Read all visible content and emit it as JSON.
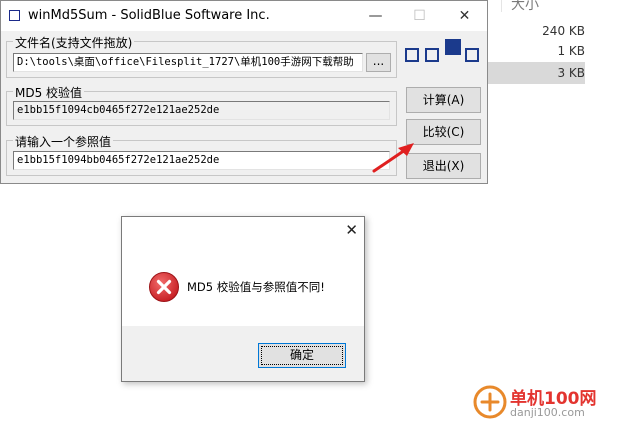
{
  "explorer": {
    "header": "大小",
    "sizes": [
      "240 KB",
      "1 KB",
      "3 KB"
    ]
  },
  "window": {
    "title": "winMd5Sum - SolidBlue Software Inc.",
    "controls": {
      "minimize": "—",
      "maximize": "☐",
      "close": "✕"
    },
    "file_group": {
      "legend": "文件名(支持文件拖放)",
      "path": "D:\\tools\\桌面\\office\\Filesplit_1727\\单机100手游网下载帮助",
      "browse": "..."
    },
    "md5_group": {
      "legend": "MD5 校验值",
      "value": "e1bb15f1094cb0465f272e121ae252de"
    },
    "ref_group": {
      "legend": "请输入一个参照值",
      "value": "e1bb15f1094bb0465f272e121ae252de"
    },
    "buttons": {
      "calc": "计算(A)",
      "compare": "比较(C)",
      "exit": "退出(X)"
    }
  },
  "dialog": {
    "close": "✕",
    "message": "MD5 校验值与参照值不同!",
    "ok": "确定"
  },
  "watermark": {
    "name": "单机100网",
    "url": "danji100.com"
  },
  "colors": {
    "accent": "#1b3a8c",
    "error": "#d9262b",
    "arrow": "#e02020",
    "watermark": "#e3342f"
  }
}
